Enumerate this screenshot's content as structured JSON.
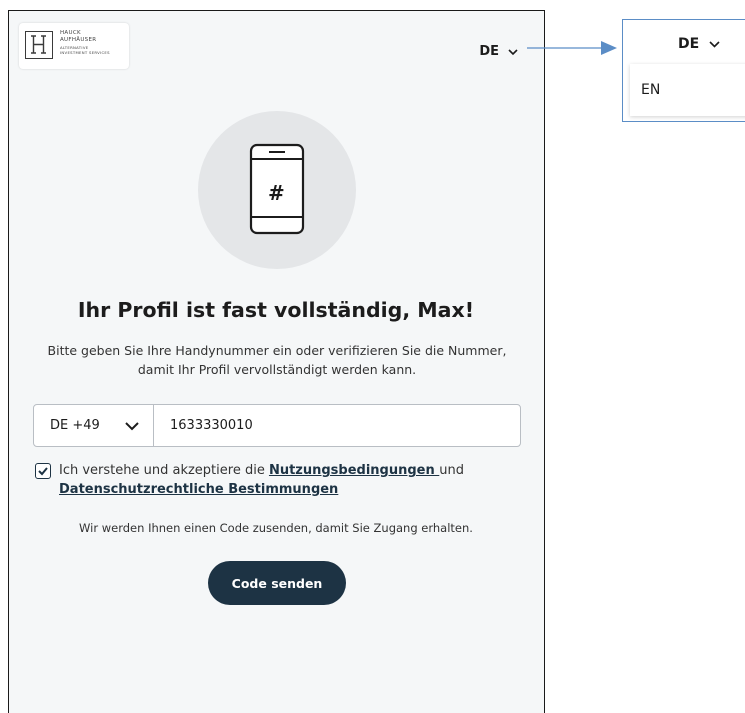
{
  "logo": {
    "line1": "HAUCK",
    "line2": "AUFHÄUSER",
    "line3": "ALTERNATIVE",
    "line4": "INVESTMENT SERVICES"
  },
  "language": {
    "current": "DE",
    "options": [
      "EN"
    ]
  },
  "hero": {
    "icon": "phone-hash-icon",
    "symbol": "#"
  },
  "title": "Ihr Profil ist fast vollständig, Max!",
  "subtitle": "Bitte geben Sie Ihre Handynummer ein oder verifizieren Sie die Nummer, damit Ihr Profil vervollständigt werden kann.",
  "phone": {
    "country_code": "DE +49",
    "number": "1633330010"
  },
  "consent": {
    "checked": true,
    "text_before": "Ich verstehe und akzeptiere die ",
    "terms_link": "Nutzungsbedingungen ",
    "text_middle": "und ",
    "privacy_link": "Datenschutzrechtliche Bestimmungen"
  },
  "info": "Wir werden Ihnen einen Code zusenden, damit Sie Zugang erhalten.",
  "send_button": "Code senden",
  "colors": {
    "primary": "#1d3344",
    "background": "#f5f7f8",
    "hero_circle": "#e4e6e8",
    "annotation": "#5b8dc6"
  }
}
